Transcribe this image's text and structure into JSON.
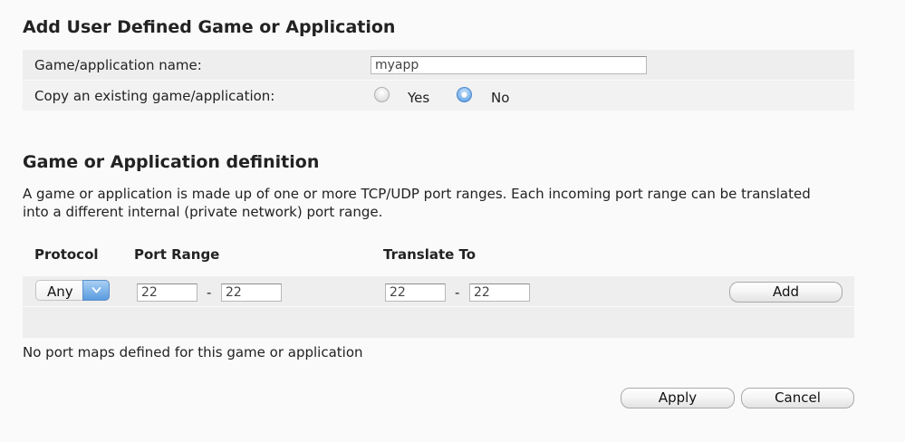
{
  "section1": {
    "title": "Add User Defined Game or Application",
    "name_label": "Game/application name:",
    "name_value": "myapp",
    "copy_label": "Copy an existing game/application:",
    "copy_options": [
      "Yes",
      "No"
    ],
    "copy_selected": "No"
  },
  "section2": {
    "title": "Game or Application definition",
    "description": "A game or application is made up of one or more TCP/UDP port ranges. Each incoming port range can be translated into a different internal (private network) port range.",
    "headers": {
      "protocol": "Protocol",
      "port_range": "Port Range",
      "translate_to": "Translate To"
    },
    "entry": {
      "protocol": "Any",
      "port_from": "22",
      "port_to": "22",
      "translate_from": "22",
      "translate_to": "22",
      "separator": "-",
      "add_label": "Add"
    },
    "empty_message": "No port maps defined for this game or application"
  },
  "footer": {
    "apply_label": "Apply",
    "cancel_label": "Cancel"
  },
  "colors": {
    "row_shade": "#eeeeee",
    "accent_blue": "#5a9be0"
  },
  "icons": {
    "select_arrow": "chevron-down-icon",
    "radio": "radio-button-icon"
  }
}
